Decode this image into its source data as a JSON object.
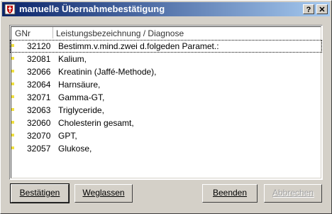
{
  "window": {
    "title": "manuelle Übernahmebestätigung",
    "help_label": "?",
    "close_label": "✕"
  },
  "table": {
    "headers": {
      "gnr": "GNr",
      "desc": "Leistungsbezeichnung / Diagnose"
    },
    "rows": [
      {
        "gnr": "32120",
        "desc": "Bestimm.v.mind.zwei d.folgeden Paramet.:"
      },
      {
        "gnr": "32081",
        "desc": "Kalium,"
      },
      {
        "gnr": "32066",
        "desc": "Kreatinin (Jaffé-Methode),"
      },
      {
        "gnr": "32064",
        "desc": "Harnsäure,"
      },
      {
        "gnr": "32071",
        "desc": "Gamma-GT,"
      },
      {
        "gnr": "32063",
        "desc": "Triglyceride,"
      },
      {
        "gnr": "32060",
        "desc": "Cholesterin gesamt,"
      },
      {
        "gnr": "32070",
        "desc": "GPT,"
      },
      {
        "gnr": "32057",
        "desc": "Glukose,"
      }
    ],
    "selected_index": 0,
    "marker_color": "#f0e040"
  },
  "buttons": {
    "bestaetigen": "Bestätigen",
    "weglassen": "Weglassen",
    "beenden": "Beenden",
    "abbrechen": "Abbrechen"
  },
  "colors": {
    "titlebar_start": "#0a246a",
    "titlebar_end": "#a6caf0",
    "face": "#d4d0c8"
  }
}
